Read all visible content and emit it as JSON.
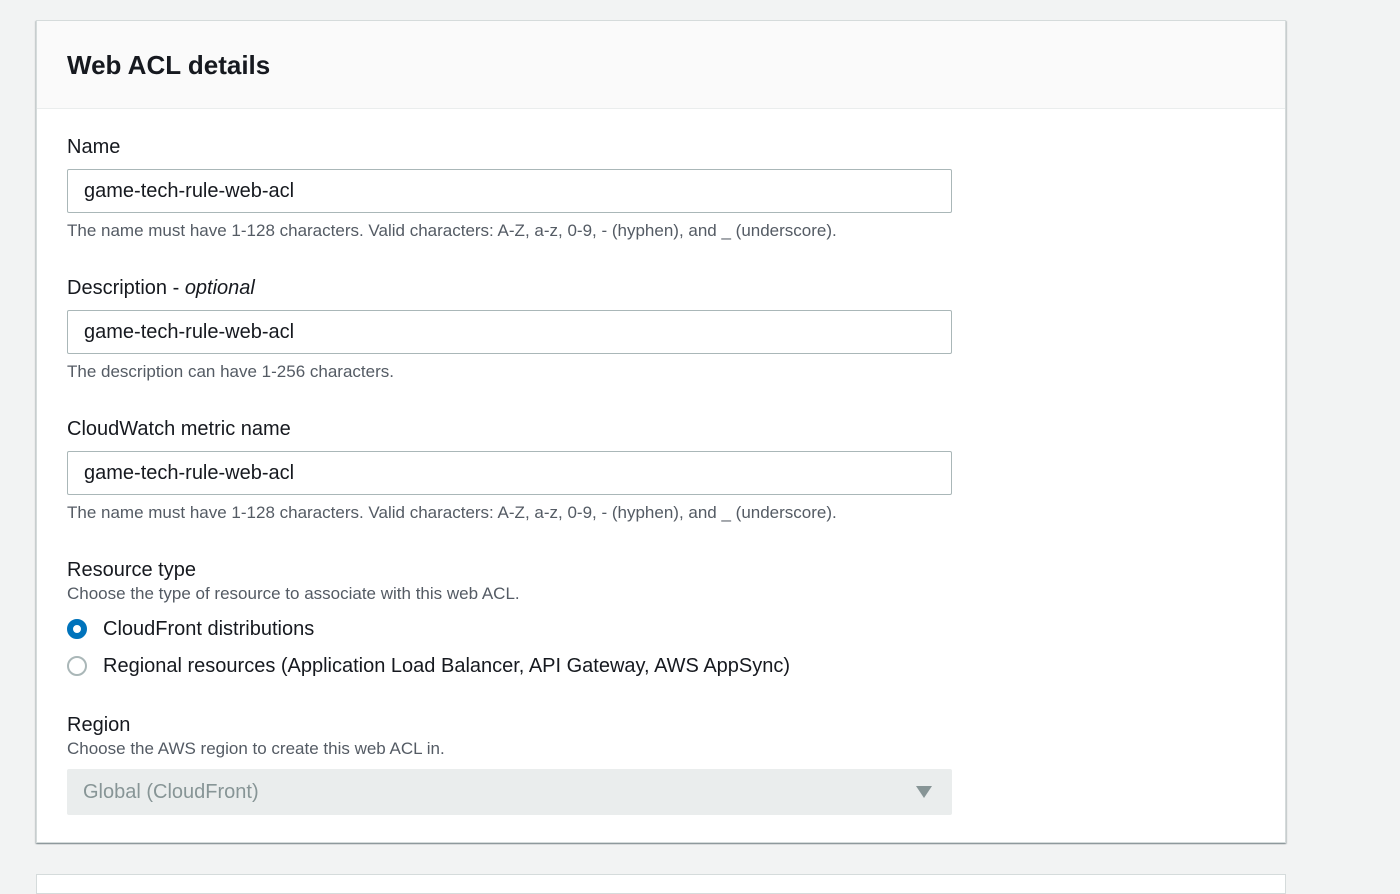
{
  "panel": {
    "title": "Web ACL details"
  },
  "name_field": {
    "label": "Name",
    "value": "game-tech-rule-web-acl",
    "hint": "The name must have 1-128 characters. Valid characters: A-Z, a-z, 0-9, - (hyphen), and _ (underscore)."
  },
  "description_field": {
    "label": "Description - ",
    "label_optional": "optional",
    "value": "game-tech-rule-web-acl",
    "hint": "The description can have 1-256 characters."
  },
  "metric_field": {
    "label": "CloudWatch metric name",
    "value": "game-tech-rule-web-acl",
    "hint": "The name must have 1-128 characters. Valid characters: A-Z, a-z, 0-9, - (hyphen), and _ (underscore)."
  },
  "resource_type": {
    "label": "Resource type",
    "hint": "Choose the type of resource to associate with this web ACL.",
    "options": [
      {
        "label": "CloudFront distributions",
        "selected": true
      },
      {
        "label": "Regional resources (Application Load Balancer, API Gateway, AWS AppSync)",
        "selected": false
      }
    ]
  },
  "region": {
    "label": "Region",
    "hint": "Choose the AWS region to create this web ACL in.",
    "selected_value": "Global (CloudFront)",
    "disabled": true
  },
  "colors": {
    "accent": "#0073bb",
    "page_background": "#f2f3f3",
    "hint_text": "#545b64",
    "disabled_text": "#879596"
  }
}
